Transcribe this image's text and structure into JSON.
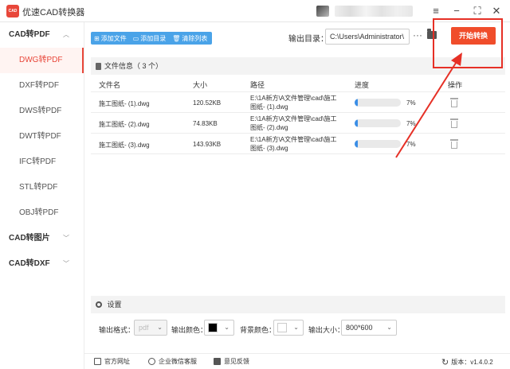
{
  "app": {
    "logo_text": "CAD",
    "title": "优速CAD转换器"
  },
  "window": {
    "menu_icon": "menu-icon",
    "min_icon": "minimize-icon",
    "max_icon": "maximize-icon",
    "close_icon": "close-icon"
  },
  "sidebar": {
    "groups": [
      {
        "label": "CAD转PDF",
        "expanded": true,
        "items": [
          "DWG转PDF",
          "DXF转PDF",
          "DWS转PDF",
          "DWT转PDF",
          "IFC转PDF",
          "STL转PDF",
          "OBJ转PDF"
        ],
        "active": "DWG转PDF"
      },
      {
        "label": "CAD转图片",
        "expanded": false
      },
      {
        "label": "CAD转DXF",
        "expanded": false
      }
    ]
  },
  "toolbar": {
    "add_file": "添加文件",
    "add_dir": "添加目录",
    "clear_list": "清除列表",
    "output_label": "输出目录：",
    "output_path": "C:\\Users\\Administrator\\",
    "more_label": "···",
    "start_label": "开始转换"
  },
  "file_panel": {
    "header": "文件信息（ 3 个）",
    "columns": [
      "文件名",
      "大小",
      "路径",
      "进度",
      "操作"
    ],
    "rows": [
      {
        "name": "施工图纸- (1).dwg",
        "size": "120.52KB",
        "path": "E:\\1A新方\\A文件管理\\cad\\施工图纸- (1).dwg",
        "progress": 7,
        "progress_label": "7%"
      },
      {
        "name": "施工图纸- (2).dwg",
        "size": "74.83KB",
        "path": "E:\\1A新方\\A文件管理\\cad\\施工图纸- (2).dwg",
        "progress": 7,
        "progress_label": "7%"
      },
      {
        "name": "施工图纸- (3).dwg",
        "size": "143.93KB",
        "path": "E:\\1A新方\\A文件管理\\cad\\施工图纸- (3).dwg",
        "progress": 7,
        "progress_label": "7%"
      }
    ]
  },
  "settings": {
    "header": "设置",
    "format_label": "输出格式：",
    "format_value": "pdf",
    "color_label": "输出颜色：",
    "color_value": "#000000",
    "bg_label": "背景颜色：",
    "bg_value": "#ffffff",
    "size_label": "输出大小：",
    "size_value": "800*600"
  },
  "footer": {
    "website": "官方网址",
    "wechat": "企业微信客服",
    "feedback": "意见反馈",
    "version": "版本：v1.4.0.2"
  },
  "colors": {
    "accent": "#e8473a",
    "start_button": "#f04d2b",
    "toolbar_blue": "#4aa3e8",
    "progress": "#3a8ee6",
    "annotation_red": "#e63026"
  }
}
